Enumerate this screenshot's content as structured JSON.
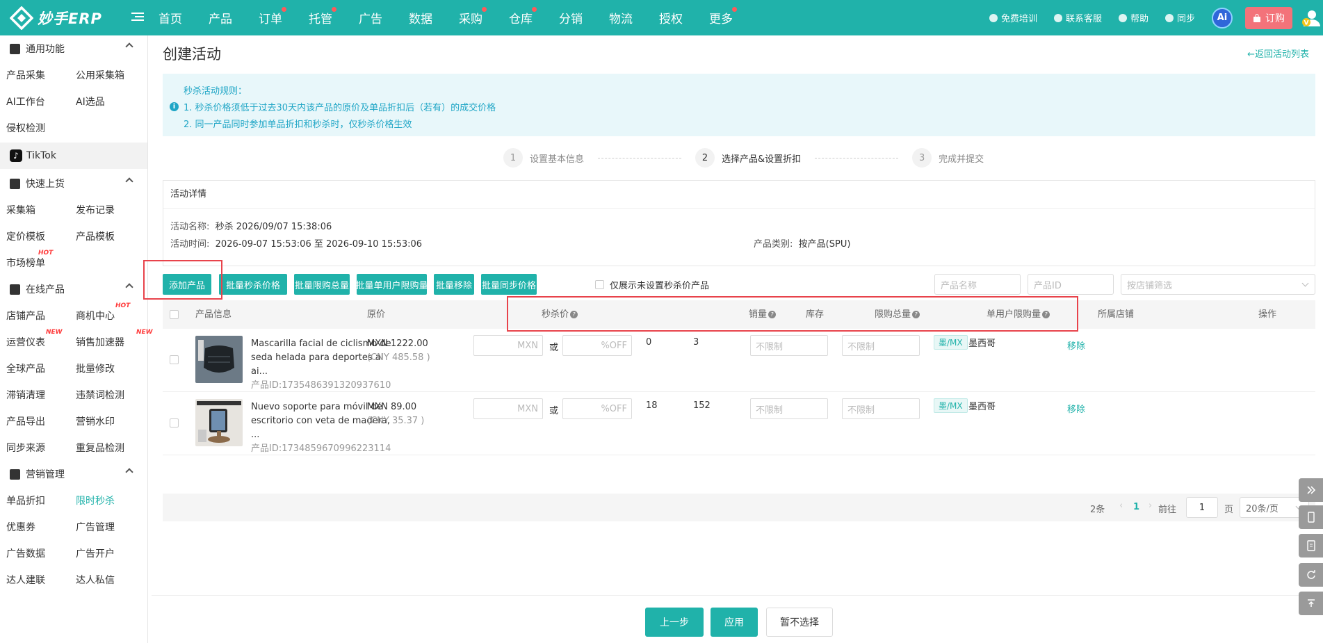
{
  "header": {
    "logo_text": "妙手ERP",
    "nav": [
      {
        "label": "首页",
        "dot": false
      },
      {
        "label": "产品",
        "dot": false
      },
      {
        "label": "订单",
        "dot": true
      },
      {
        "label": "托管",
        "dot": true
      },
      {
        "label": "广告",
        "dot": false
      },
      {
        "label": "数据",
        "dot": false
      },
      {
        "label": "采购",
        "dot": true
      },
      {
        "label": "仓库",
        "dot": true
      },
      {
        "label": "分销",
        "dot": false
      },
      {
        "label": "物流",
        "dot": false
      },
      {
        "label": "授权",
        "dot": false
      },
      {
        "label": "更多",
        "dot": true
      }
    ],
    "right": {
      "training": "免费培训",
      "support": "联系客服",
      "help": "帮助",
      "sync": "同步",
      "ai": "Ai",
      "order": "订购"
    }
  },
  "sidebar": {
    "groups": [
      {
        "title": "通用功能",
        "rows": [
          [
            "产品采集",
            "公用采集箱"
          ],
          [
            "AI工作台",
            "AI选品"
          ],
          [
            "侵权检测"
          ]
        ]
      },
      {
        "title": "快速上货",
        "rows": [
          [
            "采集箱",
            "发布记录"
          ],
          [
            "定价模板",
            "产品模板"
          ],
          [
            "市场榜单"
          ]
        ]
      },
      {
        "title": "在线产品",
        "rows": [
          [
            "店铺产品",
            "商机中心"
          ],
          [
            "运营仪表",
            "销售加速器"
          ],
          [
            "全球产品",
            "批量修改"
          ],
          [
            "滞销清理",
            "违禁词检测"
          ],
          [
            "产品导出",
            "营销水印"
          ],
          [
            "同步来源",
            "重复品检测"
          ]
        ]
      },
      {
        "title": "营销管理",
        "rows": [
          [
            "单品折扣",
            "限时秒杀"
          ],
          [
            "优惠券",
            "广告管理"
          ],
          [
            "广告数据",
            "广告开户"
          ],
          [
            "达人建联",
            "达人私信"
          ]
        ]
      }
    ],
    "tiktok": "TikTok",
    "tags": {
      "hot": "HOT",
      "new": "NEW"
    }
  },
  "page": {
    "title": "创建活动",
    "back": "←返回活动列表",
    "notice": {
      "title": "秒杀活动规则：",
      "line1": "1. 秒杀价格须低于过去30天内该产品的原价及单品折扣后（若有）的成交价格",
      "line2": "2. 同一产品同时参加单品折扣和秒杀时，仅秒杀价格生效"
    },
    "steps": [
      {
        "num": "1",
        "label": "设置基本信息"
      },
      {
        "num": "2",
        "label": "选择产品&设置折扣"
      },
      {
        "num": "3",
        "label": "完成并提交"
      }
    ],
    "detail": {
      "head": "活动详情",
      "name_label": "活动名称:",
      "name_value": "秒杀 2026/09/07 15:38:06",
      "time_label": "活动时间:",
      "time_value": "2026-09-07 15:53:06 至 2026-09-10 15:53:06",
      "type_label": "产品类别:",
      "type_value": "按产品(SPU)"
    },
    "toolbar": {
      "add": "添加产品",
      "batch_price": "批量秒杀价格",
      "batch_total": "批量限购总量",
      "batch_user": "批量单用户限购量",
      "batch_remove": "批量移除",
      "batch_sync": "批量同步价格",
      "only_unset": "仅展示未设置秒杀价产品",
      "name_ph": "产品名称",
      "id_ph": "产品ID",
      "shop_ph": "按店铺筛选"
    },
    "table": {
      "headers": {
        "info": "产品信息",
        "orig": "原价",
        "flash": "秒杀价",
        "sales": "销量",
        "stock": "库存",
        "limit_total": "限购总量",
        "limit_user": "单用户限购量",
        "shop": "所属店铺",
        "action": "操作"
      },
      "rows": [
        {
          "name": "Mascarilla facial de ciclismo de seda helada para deportes al ai...",
          "pid": "产品ID:1735486391320937610",
          "price": "MXN 1222.00",
          "cny": "(CNY 485.58 )",
          "sales": "0",
          "stock": "3",
          "shop_tag": "墨/MX",
          "shop": "墨西哥"
        },
        {
          "name": "Nuevo soporte para móvil de escritorio con veta de madera, ...",
          "pid": "产品ID:1734859670996223114",
          "price": "MXN 89.00",
          "cny": "(CNY 35.37 )",
          "sales": "18",
          "stock": "152",
          "shop_tag": "墨/MX",
          "shop": "墨西哥"
        }
      ],
      "mxn_ph": "MXN",
      "or": "或",
      "off_ph": "%OFF",
      "unlimited_ph": "不限制",
      "remove": "移除"
    },
    "pager": {
      "total": "2条",
      "current": "1",
      "goto": "前往",
      "page_input": "1",
      "page_unit": "页",
      "size": "20条/页"
    },
    "footer": {
      "prev": "上一步",
      "apply": "应用",
      "skip": "暂不选择"
    }
  }
}
